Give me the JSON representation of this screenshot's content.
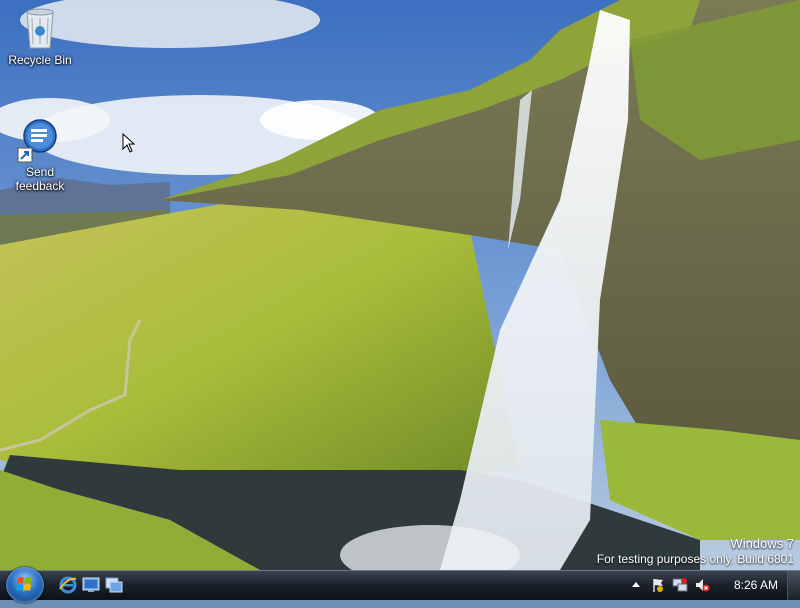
{
  "desktop": {
    "icons": [
      {
        "label": "Recycle Bin",
        "icon": "recycle-bin-icon"
      },
      {
        "label": "Send\nfeedback",
        "icon": "send-feedback-icon"
      }
    ],
    "watermark": {
      "line1": "Windows  7",
      "line2": "For testing purposes only. Build 6801"
    }
  },
  "taskbar": {
    "start_icon": "windows-start-orb-icon",
    "quick_launch": [
      "internet-explorer-icon",
      "show-desktop-icon",
      "switch-windows-icon"
    ],
    "tray_icons": [
      "show-hidden-icons-arrow",
      "action-center-flag-icon",
      "network-icon",
      "volume-muted-icon"
    ],
    "clock": "8:26 AM"
  },
  "colors": {
    "sky": "#4a78c4",
    "grass": "#a6b83a",
    "taskbar": "#1c232d"
  }
}
